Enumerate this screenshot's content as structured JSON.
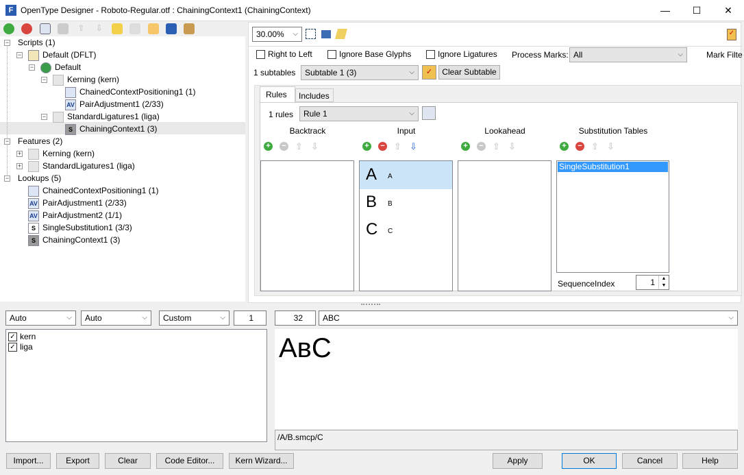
{
  "window": {
    "title": "OpenType Designer - Roboto-Regular.otf : ChainingContext1 (ChainingContext)",
    "app_icon": "F",
    "minimize": "—",
    "maximize": "☐",
    "close": "✕"
  },
  "left_toolbar": {
    "icons": [
      "add-icon",
      "remove-icon",
      "tag-icon",
      "xyz-icon",
      "up-icon",
      "down-icon",
      "tag-lightning-icon",
      "kern-wand-icon",
      "tree-icon",
      "dialog-icon",
      "broom-icon"
    ]
  },
  "tree": {
    "scripts": "Scripts (1)",
    "default_dflt": "Default (DFLT)",
    "default": "Default",
    "kerning": "Kerning (kern)",
    "ccp1": "ChainedContextPositioning1 (1)",
    "pa1": "PairAdjustment1 (2/33)",
    "stdlig": "StandardLigatures1 (liga)",
    "cc1": "ChainingContext1 (3)",
    "features": "Features (2)",
    "f_kern": "Kerning (kern)",
    "f_liga": "StandardLigatures1 (liga)",
    "lookups": "Lookups (5)",
    "l1": "ChainedContextPositioning1 (1)",
    "l2": "PairAdjustment1 (2/33)",
    "l3": "PairAdjustment2 (1/1)",
    "l4": "SingleSubstitution1 (3/3)",
    "l5": "ChainingContext1 (3)"
  },
  "right": {
    "zoom": "30.00%",
    "right_to_left": "Right to Left",
    "ignore_base": "Ignore Base Glyphs",
    "ignore_lig": "Ignore Ligatures",
    "process_marks_label": "Process Marks:",
    "process_marks": "All",
    "mark_filter": "Mark Filte",
    "subtables_count": "1 subtables",
    "subtable": "Subtable 1 (3)",
    "clear_subtable": "Clear Subtable",
    "tabs": [
      "Rules",
      "Includes"
    ],
    "rules_count": "1 rules",
    "rule": "Rule 1",
    "columns": {
      "backtrack": "Backtrack",
      "input": "Input",
      "lookahead": "Lookahead",
      "subst": "Substitution Tables"
    },
    "input_glyphs": [
      {
        "glyph": "A",
        "name": "A"
      },
      {
        "glyph": "B",
        "name": "B"
      },
      {
        "glyph": "C",
        "name": "C"
      }
    ],
    "subst_items": [
      "SingleSubstitution1"
    ],
    "sequence_index_label": "SequenceIndex",
    "sequence_index": "1"
  },
  "bottom": {
    "combo1": "Auto",
    "combo2": "Auto",
    "combo3": "Custom",
    "spin1": "1",
    "size": "32",
    "text": "ABC",
    "features": [
      {
        "label": "kern",
        "checked": true
      },
      {
        "label": "liga",
        "checked": true
      }
    ],
    "preview": "AʙC",
    "glyph_string": "/A/B.smcp/C"
  },
  "buttons": {
    "import": "Import...",
    "export": "Export",
    "clear": "Clear",
    "code_editor": "Code Editor...",
    "kern_wizard": "Kern Wizard...",
    "apply": "Apply",
    "ok": "OK",
    "cancel": "Cancel",
    "help": "Help"
  },
  "colors": {
    "selection": "#cce4f7",
    "selected_item": "#3399ff"
  }
}
